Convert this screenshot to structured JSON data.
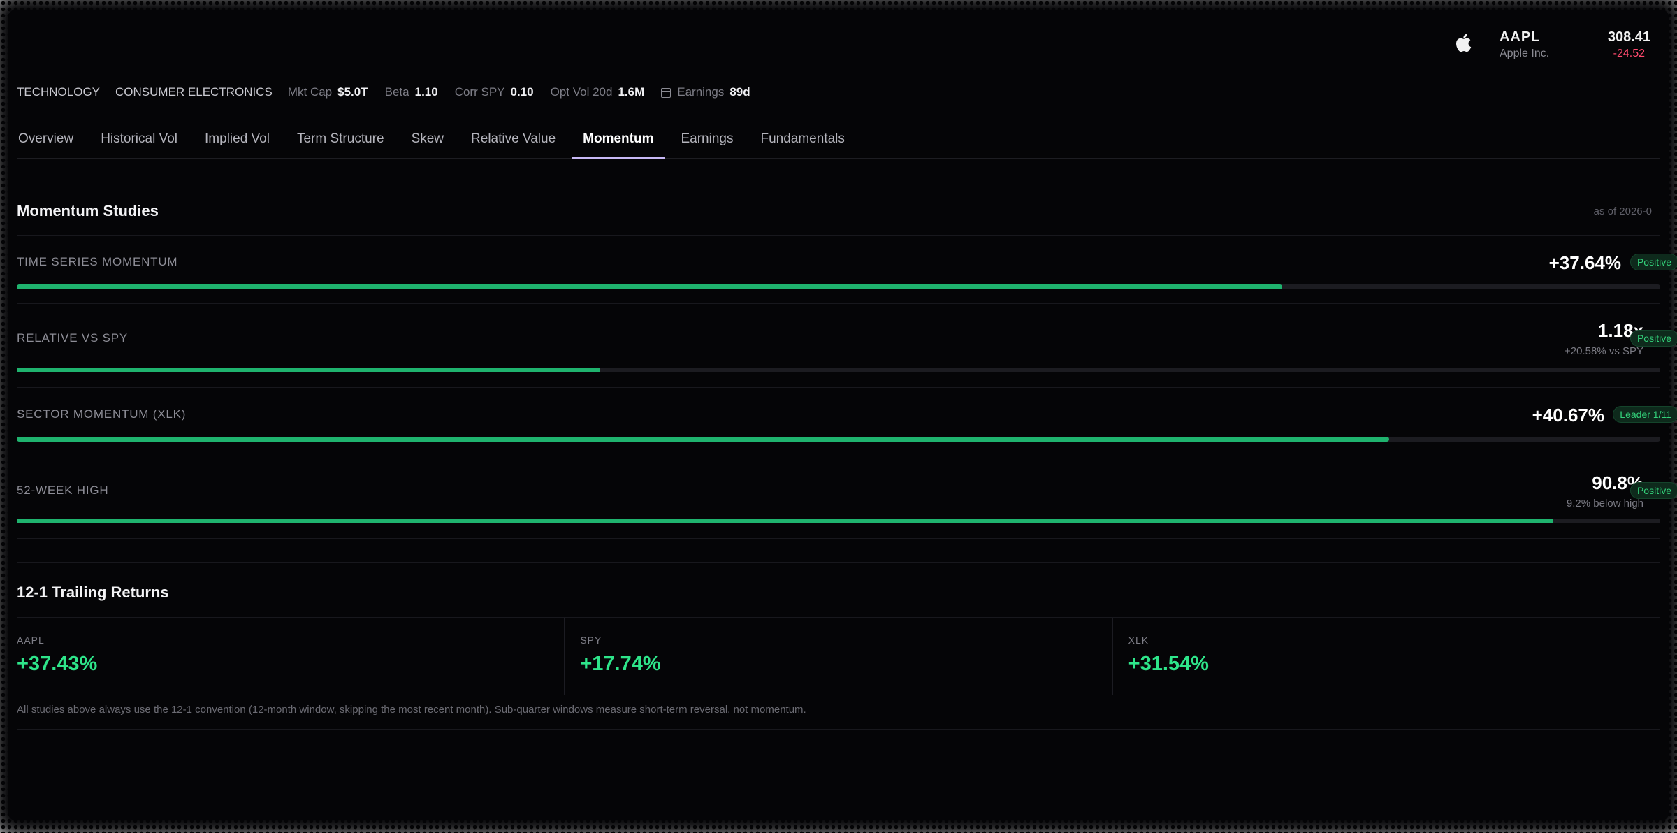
{
  "ticker": {
    "symbol": "AAPL",
    "name": "Apple Inc.",
    "price": "308.41",
    "change": "-24.52",
    "logo_icon": "apple-logo-icon"
  },
  "meta": {
    "sector": "TECHNOLOGY",
    "industry": "CONSUMER ELECTRONICS",
    "mkt_cap_label": "Mkt Cap",
    "mkt_cap": "$5.0T",
    "beta_label": "Beta",
    "beta": "1.10",
    "corr_label": "Corr SPY",
    "corr": "0.10",
    "optvol_label": "Opt Vol 20d",
    "optvol": "1.6M",
    "earnings_icon": "calendar-icon",
    "earnings_label": "Earnings",
    "earnings": "89d"
  },
  "tabs": [
    {
      "label": "Overview",
      "active": false
    },
    {
      "label": "Historical Vol",
      "active": false
    },
    {
      "label": "Implied Vol",
      "active": false
    },
    {
      "label": "Term Structure",
      "active": false
    },
    {
      "label": "Skew",
      "active": false
    },
    {
      "label": "Relative Value",
      "active": false
    },
    {
      "label": "Momentum",
      "active": true
    },
    {
      "label": "Earnings",
      "active": false
    },
    {
      "label": "Fundamentals",
      "active": false
    }
  ],
  "momentum": {
    "title": "Momentum Studies",
    "as_of": "as of 2026-0",
    "rows": [
      {
        "label": "TIME SERIES MOMENTUM",
        "value": "+37.64%",
        "badge": "Positive",
        "progress": 0.77
      },
      {
        "label": "RELATIVE VS SPY",
        "value": "1.18x",
        "sub": "+20.58% vs SPY",
        "badge": "Positive",
        "progress": 0.355
      },
      {
        "label": "SECTOR MOMENTUM (XLK)",
        "value": "+40.67%",
        "badge": "Leader 1/11",
        "progress": 0.835
      },
      {
        "label": "52-WEEK HIGH",
        "value": "90.8%",
        "sub": "9.2% below high",
        "badge": "Positive",
        "progress": 0.935
      }
    ]
  },
  "returns": {
    "title": "12-1 Trailing Returns",
    "cells": [
      {
        "label": "AAPL",
        "value": "+37.43%"
      },
      {
        "label": "SPY",
        "value": "+17.74%"
      },
      {
        "label": "XLK",
        "value": "+31.54%"
      }
    ],
    "footnote": "All studies above always use the 12-1 convention (12-month window, skipping the most recent month). Sub-quarter windows measure short-term reversal, not momentum."
  },
  "colors": {
    "background": "#050507",
    "accent_tab": "#c7b8f5",
    "progress_fill": "#1fb36e",
    "positive": "#2ee58a",
    "negative": "#ff4a6e"
  }
}
